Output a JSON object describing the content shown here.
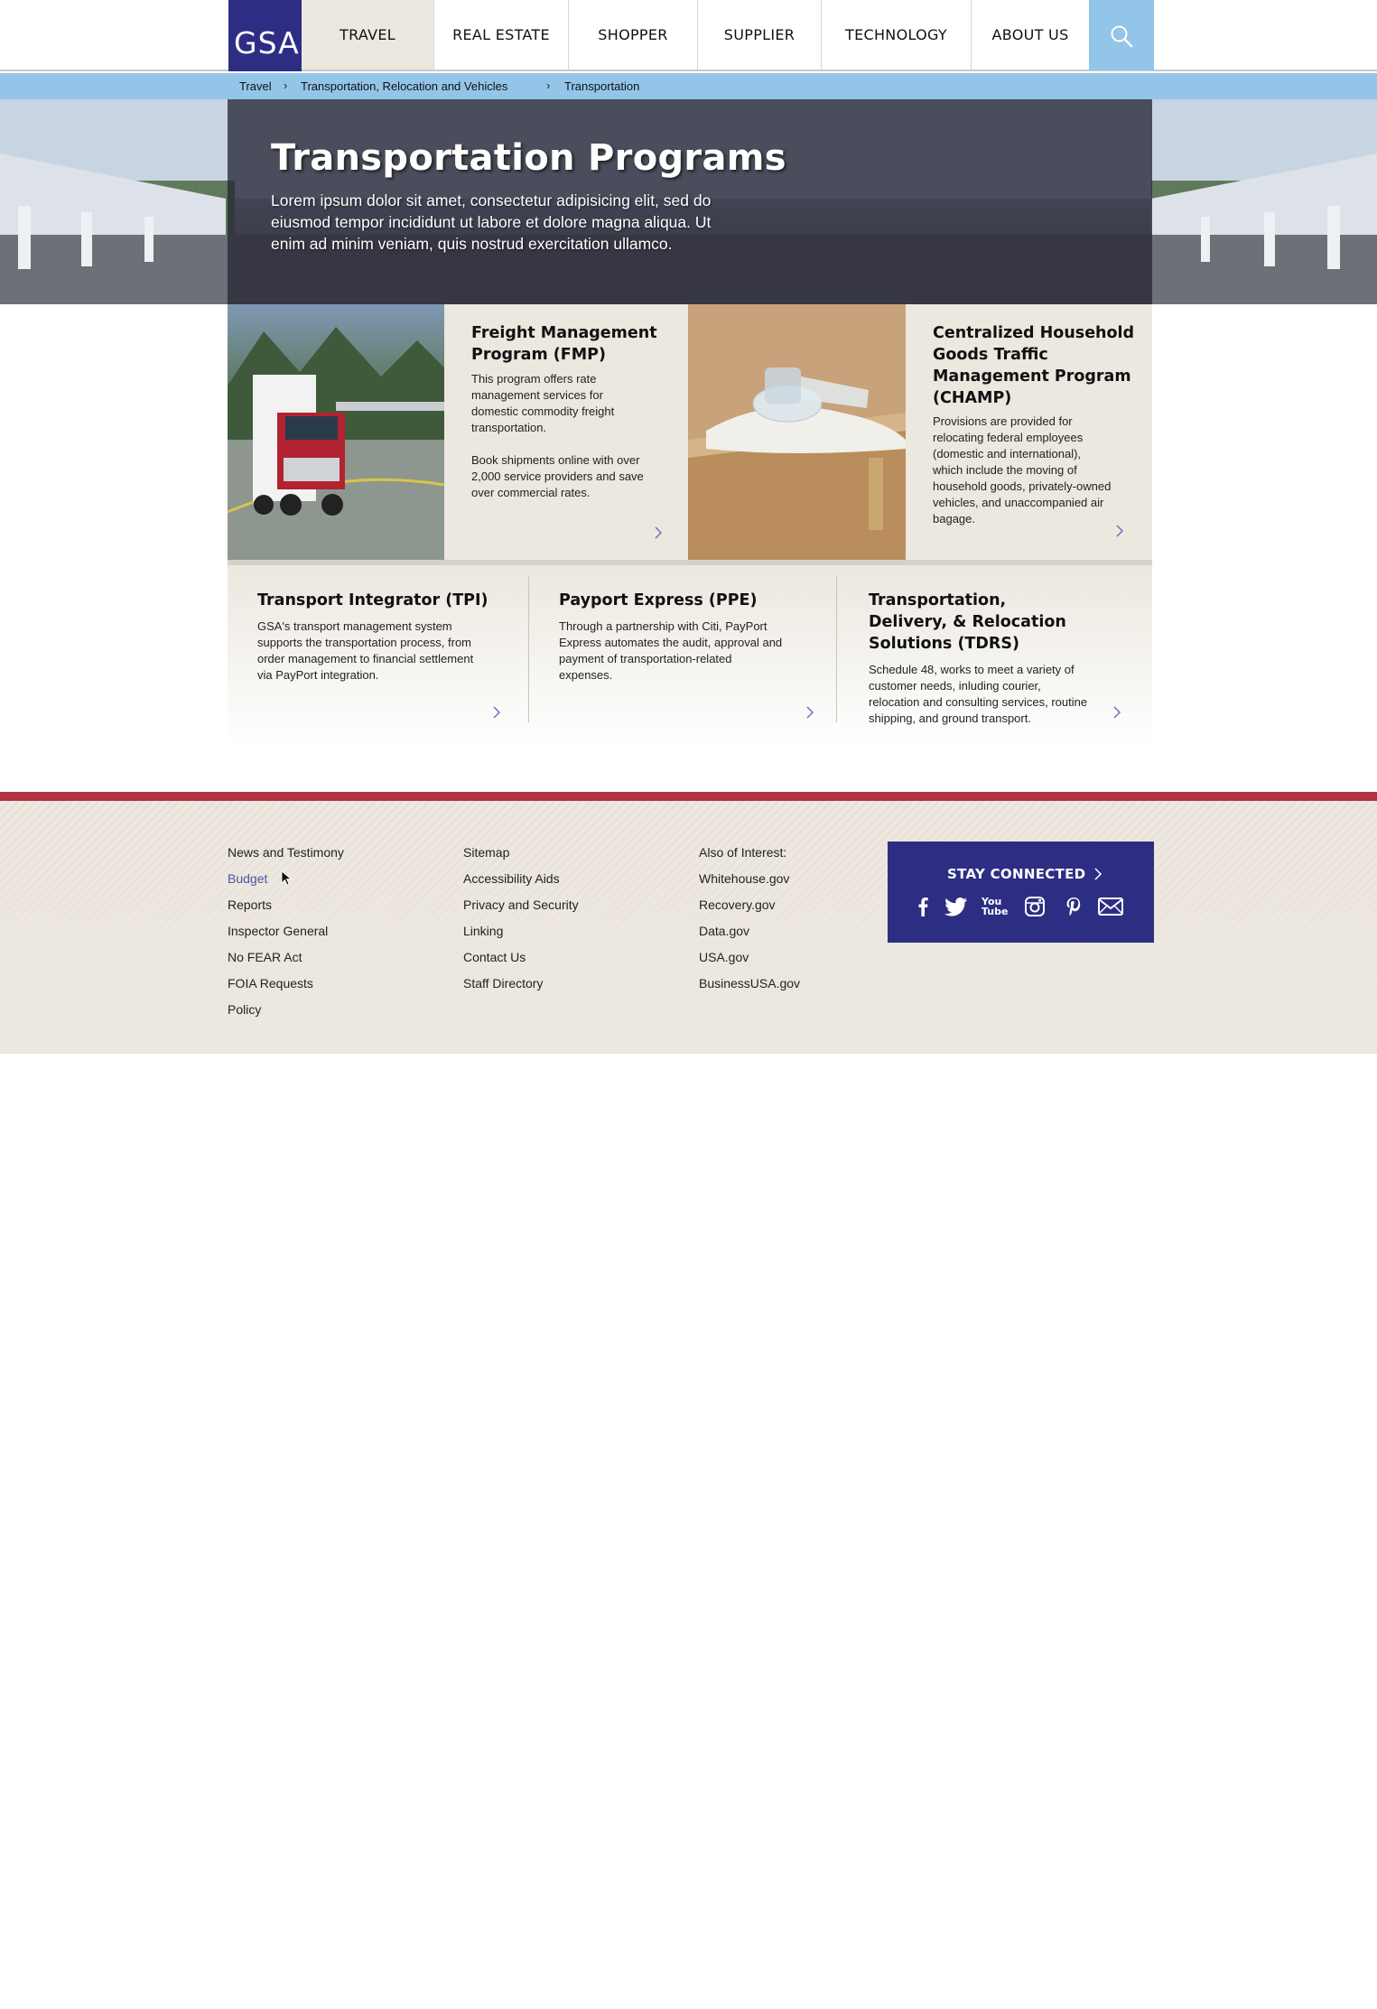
{
  "brand": {
    "logo_text": "GSA",
    "primary_color": "#2d2e83",
    "accent_blue": "#93c5e8",
    "accent_red": "#b0333f",
    "beige": "#ece7df"
  },
  "nav": {
    "items": [
      {
        "label": "TRAVEL",
        "active": true
      },
      {
        "label": "REAL ESTATE",
        "active": false
      },
      {
        "label": "SHOPPER",
        "active": false
      },
      {
        "label": "SUPPLIER",
        "active": false
      },
      {
        "label": "TECHNOLOGY",
        "active": false
      },
      {
        "label": "ABOUT US",
        "active": false
      }
    ],
    "search_icon": "search-icon"
  },
  "breadcrumb": [
    "Travel",
    "Transportation, Relocation and Vehicles",
    "Transportation"
  ],
  "hero": {
    "title": "Transportation Programs",
    "text": "Lorem ipsum dolor sit amet, consectetur adipisicing elit, sed do eiusmod tempor incididunt ut labore et dolore magna aliqua. Ut enim ad minim veniam, quis nostrud exercitation ullamco."
  },
  "features": [
    {
      "title": "Freight Management Program (FMP)",
      "desc1": "This program offers rate management services for domestic commodity freight transportation.",
      "desc2": "Book shipments online with over 2,000 service providers and save over commercial rates."
    },
    {
      "title": "Centralized Household Goods Traffic Management Program (CHAMP)",
      "desc1": "Provisions are provided for relocating federal employees (domestic and international), which include the moving of household goods, privately-owned vehicles, and unaccompanied air bagage."
    }
  ],
  "programs": [
    {
      "title": "Transport Integrator (TPI)",
      "desc": "GSA's transport management system supports the transportation process, from order management to financial settlement via PayPort integration."
    },
    {
      "title": "Payport Express (PPE)",
      "desc": "Through a partnership with Citi, PayPort Express automates the audit, approval and payment of transportation-related expenses."
    },
    {
      "title": "Transportation, Delivery, & Relocation Solutions (TDRS)",
      "desc": "Schedule 48, works to meet a variety of customer needs, inluding courier, relocation and consulting services, routine shipping, and ground transport."
    }
  ],
  "footer": {
    "col1": [
      "News and Testimony",
      "Budget",
      "Reports",
      "Inspector General",
      "No FEAR Act",
      "FOIA Requests",
      "Policy"
    ],
    "col2": [
      "Sitemap",
      "Accessibility Aids",
      "Privacy and Security",
      "Linking",
      "Contact Us",
      "Staff Directory"
    ],
    "col3": [
      "Also of Interest:",
      "Whitehouse.gov",
      "Recovery.gov",
      "Data.gov",
      "USA.gov",
      "BusinessUSA.gov"
    ],
    "stay_connected": "STAY CONNECTED",
    "social_icons": [
      "facebook-icon",
      "twitter-icon",
      "youtube-icon",
      "instagram-icon",
      "pinterest-icon",
      "email-icon"
    ],
    "youtube_text": "You Tube"
  }
}
